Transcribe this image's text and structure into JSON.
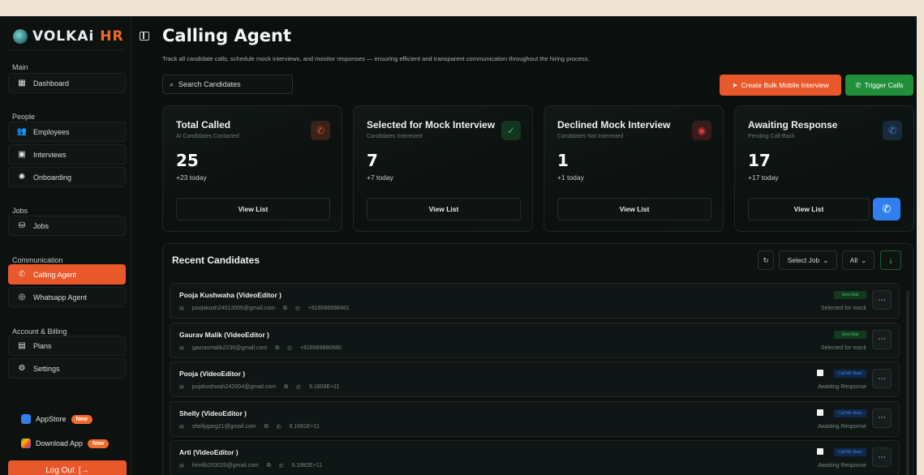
{
  "brand": {
    "logo_text_a": "VOLKAi ",
    "logo_text_b": "HR"
  },
  "sidebar": {
    "sections": [
      {
        "title": "Main",
        "items": [
          {
            "label": "Dashboard",
            "icon": "dashboard-icon"
          }
        ]
      },
      {
        "title": "People",
        "items": [
          {
            "label": "Employees",
            "icon": "users-icon"
          },
          {
            "label": "Interviews",
            "icon": "interviews-icon"
          },
          {
            "label": "Onboarding",
            "icon": "onboarding-icon"
          }
        ]
      },
      {
        "title": "Jobs",
        "items": [
          {
            "label": "Jobs",
            "icon": "jobs-icon"
          }
        ]
      },
      {
        "title": "Communication",
        "items": [
          {
            "label": "Calling Agent",
            "icon": "phone-icon"
          },
          {
            "label": "Whatsapp Agent",
            "icon": "whatsapp-icon"
          }
        ]
      },
      {
        "title": "Account & Billing",
        "items": [
          {
            "label": "Plans",
            "icon": "plans-icon"
          },
          {
            "label": "Settings",
            "icon": "gear-icon"
          }
        ]
      }
    ],
    "appstore": {
      "label": "AppStore",
      "badge": "New"
    },
    "download": {
      "label": "Download App",
      "badge": "New"
    },
    "logout": "Log Out"
  },
  "header": {
    "title": "Calling Agent",
    "subtitle": "Track all candidate calls, schedule mock interviews, and monitor responses — ensuring efficient and transparent communication throughout the hiring process.",
    "search_placeholder": "Search Candidates",
    "bulk_button": "Create Bulk Mobile Interview",
    "trigger_button": "Trigger Calls"
  },
  "stats": [
    {
      "title": "Total Called",
      "sub": "AI Candidates Contacted",
      "value": "25",
      "today": "+23 today",
      "action": "View List",
      "icon": "phone-icon",
      "color": "#e9582a"
    },
    {
      "title": "Selected for Mock Interview",
      "sub": "Candidates Interested",
      "value": "7",
      "today": "+7 today",
      "action": "View List",
      "icon": "check-circle-icon",
      "color": "#2fbf5a"
    },
    {
      "title": "Declined Mock Interview",
      "sub": "Candidates Not Interested",
      "value": "1",
      "today": "+1 today",
      "action": "View List",
      "icon": "declined-icon",
      "color": "#e03b3b"
    },
    {
      "title": "Awaiting Response",
      "sub": "Pending Call-Back",
      "value": "17",
      "today": "+17 today",
      "action": "View List",
      "icon": "phone-pending-icon",
      "color": "#3f86e5"
    }
  ],
  "recent": {
    "title": "Recent Candidates",
    "select_job": "Select Job",
    "filter": "All",
    "rows": [
      {
        "name": "Pooja Kushwaha  (VideoEditor )",
        "email": "poojakush24012005@gmail.com",
        "phone": "+918096898481",
        "tag": "Sent Mail",
        "tag_type": "g",
        "status": "Selected for mock"
      },
      {
        "name": "Gaurav Malik  (VideoEditor )",
        "email": "gauravmalik2236@gmail.com",
        "phone": "+918569890680",
        "tag": "Sent Mail",
        "tag_type": "g",
        "status": "Selected for mock"
      },
      {
        "name": "Pooja  (VideoEditor )",
        "email": "pujakushwah242004@gmail.com",
        "phone": "9.1809E+11",
        "tag": "Call Me Back",
        "tag_type": "b",
        "status": "Awaiting Response"
      },
      {
        "name": "Shelly  (VideoEditor )",
        "email": "shellygarg21@gmail.com",
        "phone": "9.1991E+11",
        "tag": "Call Me Back",
        "tag_type": "b",
        "status": "Awaiting Response"
      },
      {
        "name": "Arti  (VideoEditor )",
        "email": "hrivills203020@gmail.com",
        "phone": "9.1882E+11",
        "tag": "Call Me Back",
        "tag_type": "b",
        "status": "Awaiting Response"
      }
    ]
  }
}
